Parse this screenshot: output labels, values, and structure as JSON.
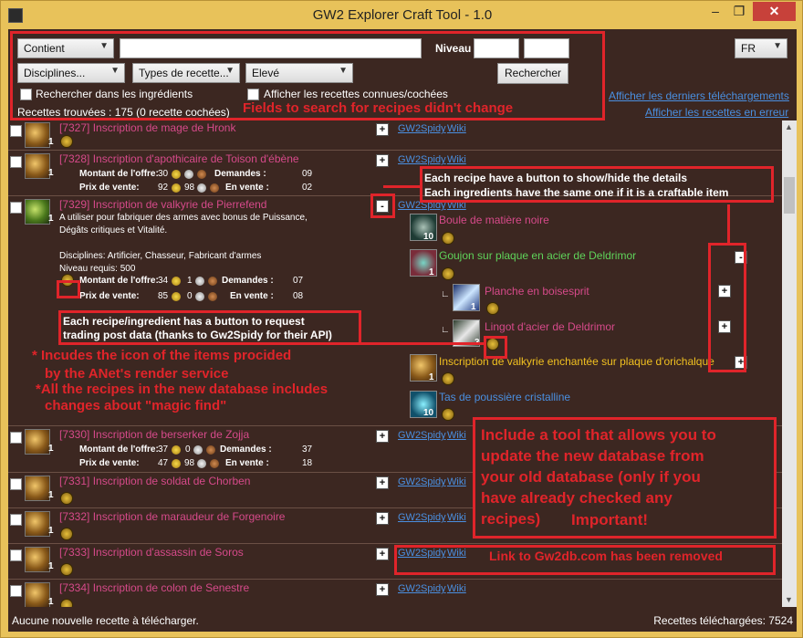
{
  "window": {
    "title": "GW2 Explorer Craft Tool - 1.0",
    "min": "–",
    "max": "❐",
    "close": "✕"
  },
  "search": {
    "contains": "Contient",
    "level_label": "Niveau",
    "language": "FR",
    "disciplines": "Disciplines...",
    "types": "Types de recette...",
    "rarity": "Elevé",
    "search_button": "Rechercher",
    "in_ingredients": "Rechercher dans les ingrédients",
    "show_known": "Afficher les recettes connues/cochées",
    "found": "Recettes trouvées : 175 (0 recette cochées)",
    "link_downloads": "Afficher les derniers téléchargements",
    "link_errors": "Afficher les recettes en erreur"
  },
  "labels": {
    "offer": "Montant de l'offre:",
    "demands": "Demandes :",
    "sell": "Prix de vente:",
    "on_sale": "En vente :",
    "gw2spidy": "GW2Spidy",
    "wiki": "Wiki",
    "plus": "+",
    "minus": "-"
  },
  "recipes": [
    {
      "id": "[7327] Inscription de mage de Hronk",
      "qty": "1"
    },
    {
      "id": "[7328] Inscription d'apothicaire de Toison d'ébène",
      "qty": "1",
      "offer_g": "30",
      "offer_s": "",
      "offer_c": "",
      "demands": "09",
      "sell_g": "92",
      "sell_s": "98",
      "sell_c": "",
      "on_sale": "02"
    },
    {
      "id": "[7329] Inscription de valkyrie de Pierrefend",
      "qty": "1",
      "desc1": "A utiliser pour fabriquer des armes avec bonus de Puissance,",
      "desc2": "Dégâts critiques et Vitalité.",
      "disc": "Disciplines: Artificier, Chasseur, Fabricant d'armes",
      "level": "Niveau requis: 500",
      "offer_g": "34",
      "offer_s": "1",
      "demands": "07",
      "sell_g": "85",
      "sell_s": "0",
      "on_sale": "08"
    },
    {
      "id": "[7330] Inscription de berserker de Zojja",
      "qty": "1",
      "offer_g": "37",
      "offer_s": "0",
      "demands": "37",
      "sell_g": "47",
      "sell_s": "98",
      "on_sale": "18"
    },
    {
      "id": "[7331] Inscription de soldat de Chorben",
      "qty": "1"
    },
    {
      "id": "[7332] Inscription de maraudeur de Forgenoire",
      "qty": "1"
    },
    {
      "id": "[7333] Inscription d'assassin de Soros",
      "qty": "1"
    },
    {
      "id": "[7334] Inscription de colon de Senestre",
      "qty": "1"
    }
  ],
  "ingredients": [
    {
      "name": "Boule de matière noire",
      "qty": "10",
      "color": "#d64a8a"
    },
    {
      "name": "Goujon sur plaque en acier de Deldrimor",
      "qty": "1",
      "color": "#5fd35a"
    },
    {
      "name": "Planche en boisesprit",
      "qty": "1",
      "color": "#d64a8a"
    },
    {
      "name": "Lingot d'acier de Deldrimor",
      "qty": "3",
      "color": "#d64a8a"
    },
    {
      "name": "Inscription de valkyrie enchantée sur plaque d'orichalque",
      "qty": "1",
      "color": "#f0c020"
    },
    {
      "name": "Tas de poussière cristalline",
      "qty": "10",
      "color": "#4a8fe0"
    }
  ],
  "annotations": {
    "a1": "Fields to search for recipes didn't change",
    "a2a": "Each recipe have a button to show/hide the details",
    "a2b": "Each ingredients have the same one if it is a craftable item",
    "a3a": "Each recipe/ingredient has a button to request",
    "a3b": "trading post data (thanks to Gw2Spidy for their API)",
    "a4a": "* Incudes the icon of the items procided",
    "a4b": "by the ANet's render service",
    "a5a": "*All the recipes in the new database includes",
    "a5b": "changes about \"magic find\"",
    "a6a": "Include a tool that allows you to",
    "a6b": "update the new database from",
    "a6c": "your old database (only if you",
    "a6d": "have already checked any",
    "a6e": "recipes)",
    "a6f": "Important!",
    "a7": "Link to Gw2db.com has been removed"
  },
  "status": {
    "left": "Aucune nouvelle recette à télécharger.",
    "right": "Recettes téléchargées: 7524"
  },
  "colors": {
    "accent": "#e0242a",
    "epic": "#d64a8a",
    "link": "#4a8fe0",
    "background": "#3c2721"
  }
}
